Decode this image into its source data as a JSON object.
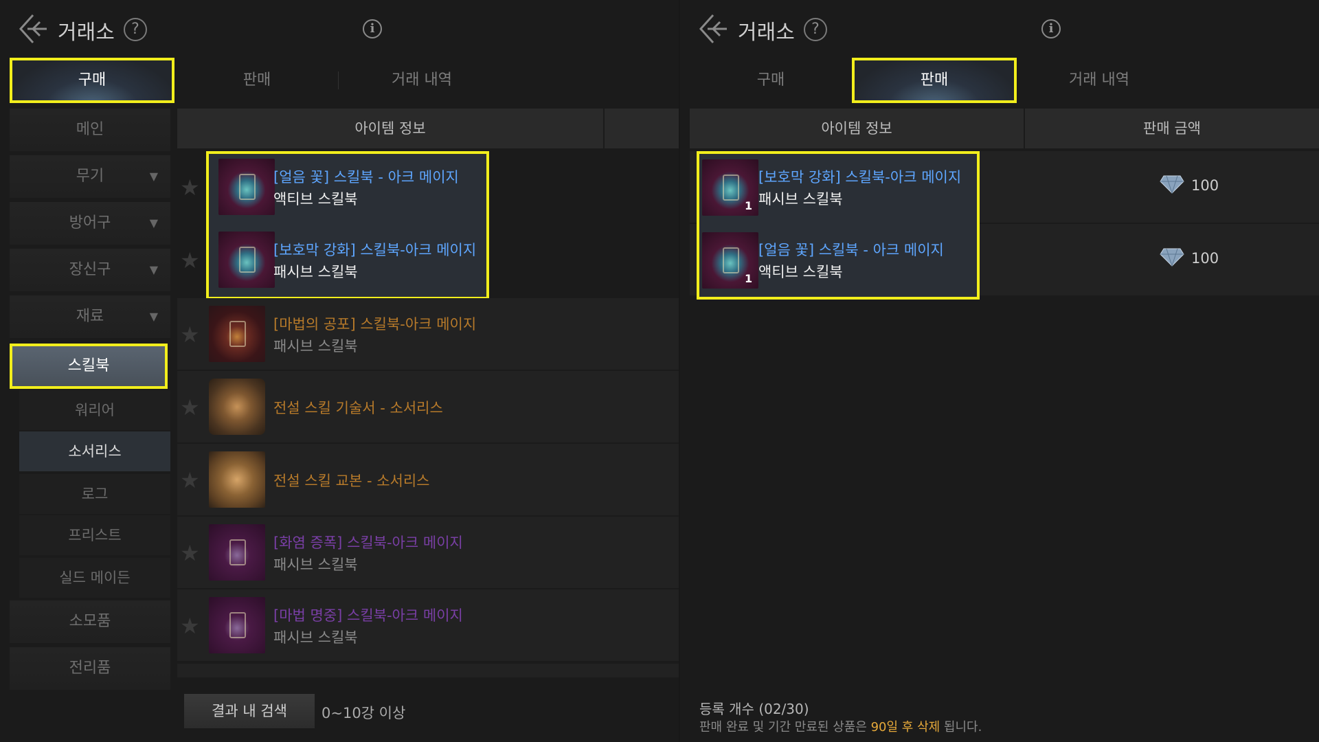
{
  "colors": {
    "highlight": "#f2ee1c",
    "blue_item": "#5ea6ff",
    "orange_item": "#b77a2a",
    "purple_item": "#7a3fa6",
    "notice_highlight": "#e6a93a"
  },
  "left": {
    "header": {
      "title": "거래소",
      "help_icon": "question-icon",
      "info_icon": "info-icon",
      "back_icon": "back-arrow-icon"
    },
    "tabs": [
      {
        "label": "구매",
        "active": true
      },
      {
        "label": "판매",
        "active": false
      },
      {
        "label": "거래 내역",
        "active": false
      }
    ],
    "sidebar": {
      "items": [
        {
          "label": "메인"
        },
        {
          "label": "무기"
        },
        {
          "label": "방어구"
        },
        {
          "label": "장신구"
        },
        {
          "label": "재료"
        },
        {
          "label": "스킬북"
        }
      ],
      "subitems": [
        {
          "label": "워리어"
        },
        {
          "label": "소서리스"
        },
        {
          "label": "로그"
        },
        {
          "label": "프리스트"
        },
        {
          "label": "실드 메이든"
        }
      ],
      "bottom_items": [
        {
          "label": "소모품"
        },
        {
          "label": "전리품"
        }
      ]
    },
    "table_header": {
      "item_info": "아이템 정보"
    },
    "items": [
      {
        "name": "[얼음 꽃] 스킬북 - 아크 메이지",
        "type": "액티브 스킬북"
      },
      {
        "name": "[보호막 강화] 스킬북-아크 메이지",
        "type": "패시브 스킬북"
      },
      {
        "name": "[마법의 공포] 스킬북-아크 메이지",
        "type": "패시브 스킬북"
      },
      {
        "name": "전설 스킬 기술서 - 소서리스",
        "type": ""
      },
      {
        "name": "전설 스킬 교본 - 소서리스",
        "type": ""
      },
      {
        "name": "[화염 증폭] 스킬북-아크 메이지",
        "type": "패시브 스킬북"
      },
      {
        "name": "[마법 명중] 스킬북-아크 메이지",
        "type": "패시브 스킬북"
      }
    ],
    "footer": {
      "search_button": "결과 내 검색",
      "filter": "0~10강 이상"
    }
  },
  "right": {
    "header": {
      "title": "거래소"
    },
    "tabs": [
      {
        "label": "구매",
        "active": false
      },
      {
        "label": "판매",
        "active": true
      },
      {
        "label": "거래 내역",
        "active": false
      }
    ],
    "table_header": {
      "item_info": "아이템 정보",
      "price": "판매 금액"
    },
    "items": [
      {
        "name": "[보호막 강화] 스킬북-아크 메이지",
        "type": "패시브 스킬북",
        "qty": "1",
        "price": "100"
      },
      {
        "name": "[얼음 꽃] 스킬북 - 아크 메이지",
        "type": "액티브 스킬북",
        "qty": "1",
        "price": "100"
      }
    ],
    "footer": {
      "reg_count": "등록 개수 (02/30)",
      "notice_pre": "판매 완료 및 기간 만료된 상품은 ",
      "notice_hi": "90일 후 삭제",
      "notice_post": " 됩니다."
    }
  }
}
